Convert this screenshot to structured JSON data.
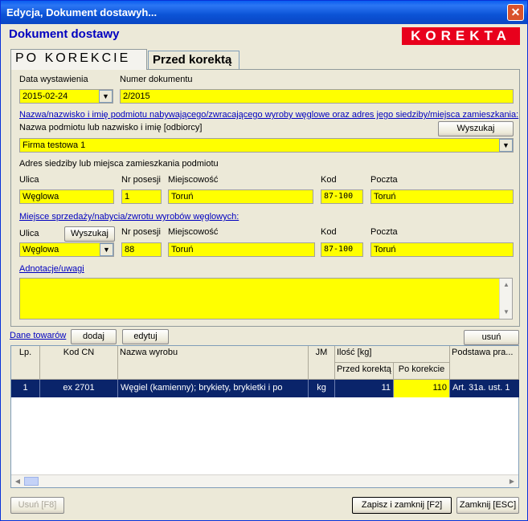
{
  "window": {
    "title": "Edycja, Dokument dostawyh...",
    "close_glyph": "✕"
  },
  "header": {
    "title": "Dokument dostawy",
    "badge": "KOREKTA"
  },
  "tabs": [
    {
      "label": "PO KOREKCIE"
    },
    {
      "label": "Przed korektą"
    }
  ],
  "form": {
    "data_label": "Data wystawienia",
    "data_value": "2015-02-24",
    "numer_label": "Numer dokumentu",
    "numer_value": "2/2015",
    "nabywca_link": "Nazwa/nazwisko i imię podmiotu nabywającego/zwracającego wyroby węglowe oraz adres jego siedziby/miejsca zamieszkania:",
    "nazwa_label": "Nazwa podmiotu lub nazwisko i imię [odbiorcy]",
    "wyszukaj_label": "Wyszukaj",
    "nazwa_value": "Firma testowa 1",
    "adres_label": "Adres siedziby lub miejsca zamieszkania podmiotu",
    "addr1": {
      "ulica_label": "Ulica",
      "ulica_value": "Węglowa",
      "nr_label": "Nr posesji",
      "nr_value": "1",
      "miasto_label": "Miejscowość",
      "miasto_value": "Toruń",
      "kod_label": "Kod",
      "kod_value": "87-100",
      "poczta_label": "Poczta",
      "poczta_value": "Toruń"
    },
    "miejsce_link": "Miejsce sprzedaży/nabycia/zwrotu wyrobów węglowych:",
    "addr2": {
      "ulica_label": "Ulica",
      "wyszukaj_label": "Wyszukaj",
      "ulica_value": "Węglowa",
      "nr_label": "Nr posesji",
      "nr_value": "88",
      "miasto_label": "Miejscowość",
      "miasto_value": "Toruń",
      "kod_label": "Kod",
      "kod_value": "87-100",
      "poczta_label": "Poczta",
      "poczta_value": "Toruń"
    },
    "uwagi_link": "Adnotacje/uwagi",
    "uwagi_value": ""
  },
  "goods": {
    "link": "Dane towarów",
    "add_label": "dodaj",
    "edit_label": "edytuj",
    "delete_label": "usuń",
    "columns": {
      "lp": "Lp.",
      "kod": "Kod CN",
      "nazwa": "Nazwa wyrobu",
      "jm": "JM",
      "ilosc": "Ilość [kg]",
      "przed": "Przed korektą",
      "po": "Po korekcie",
      "podstawa": "Podstawa pra..."
    },
    "rows": [
      {
        "lp": "1",
        "kod": "ex 2701",
        "nazwa": "Węgiel (kamienny); brykiety, brykietki i po",
        "jm": "kg",
        "przed": "11",
        "po": "110",
        "podstawa": "Art. 31a. ust. 1"
      }
    ]
  },
  "footer": {
    "usun_label": "Usuń [F8]",
    "save_label": "Zapisz i zamknij [F2]",
    "close_label": "Zamknij [ESC]"
  },
  "colors": {
    "field": "#ffff00",
    "badge": "#e8001c",
    "title": "#0000c0",
    "selection": "#0a246a"
  }
}
